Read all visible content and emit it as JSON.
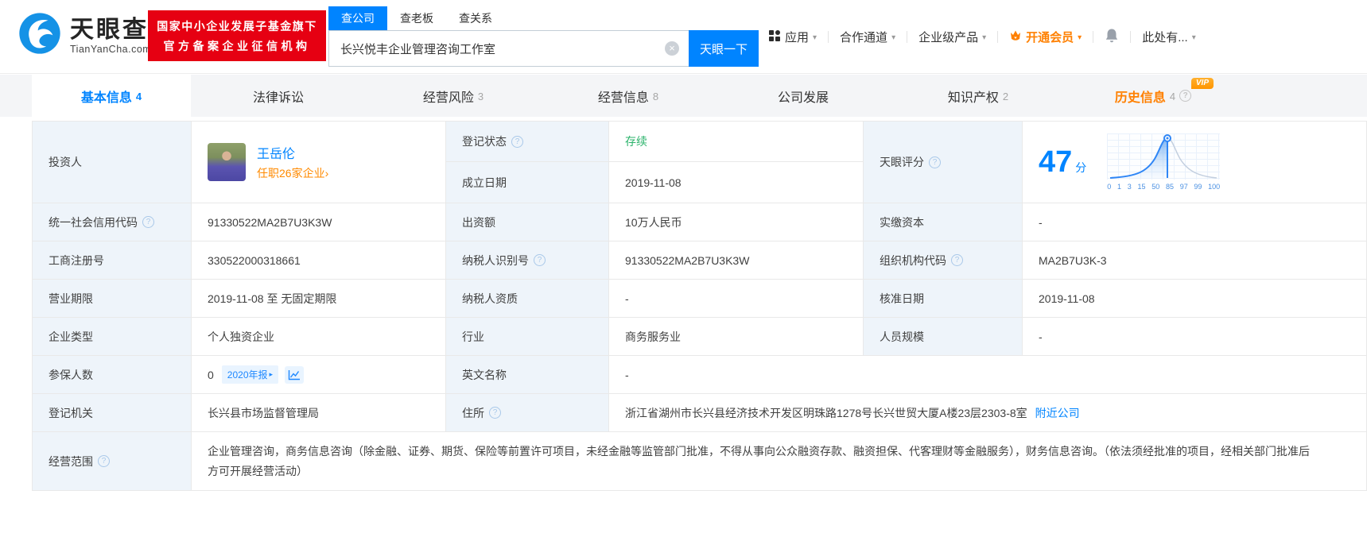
{
  "header": {
    "logo": {
      "brand": "天眼查",
      "domain": "TianYanCha.com"
    },
    "badge": {
      "line1": "国家中小企业发展子基金旗下",
      "line2": "官方备案企业征信机构"
    },
    "search": {
      "tabs": [
        {
          "label": "查公司"
        },
        {
          "label": "查老板"
        },
        {
          "label": "查关系"
        }
      ],
      "input_value": "长兴悦丰企业管理咨询工作室",
      "button": "天眼一下"
    },
    "nav": [
      {
        "label": "应用"
      },
      {
        "label": "合作通道"
      },
      {
        "label": "企业级产品"
      },
      {
        "label": "开通会员"
      },
      {
        "label": "此处有..."
      }
    ]
  },
  "tabs": [
    {
      "label": "基本信息",
      "count": "4"
    },
    {
      "label": "法律诉讼"
    },
    {
      "label": "经营风险",
      "count": "3"
    },
    {
      "label": "经营信息",
      "count": "8"
    },
    {
      "label": "公司发展"
    },
    {
      "label": "知识产权",
      "count": "2"
    },
    {
      "label": "历史信息",
      "count": "4",
      "vip": "VIP"
    }
  ],
  "profile": {
    "investor_label": "投资人",
    "investor_name": "王岳伦",
    "investor_link": "任职26家企业›",
    "reg_status_label": "登记状态",
    "reg_status_value": "存续",
    "establish_label": "成立日期",
    "establish_value": "2019-11-08",
    "score_label": "天眼评分"
  },
  "score": {
    "value": "47",
    "unit": "分",
    "ticks": [
      "0",
      "1",
      "3",
      "15",
      "50",
      "85",
      "97",
      "99",
      "100"
    ]
  },
  "rows": [
    {
      "l1": "统一社会信用代码",
      "v1": "91330522MA2B7U3K3W",
      "l2": "出资额",
      "v2": "10万人民币",
      "l3": "实缴资本",
      "v3": "-"
    },
    {
      "l1": "工商注册号",
      "v1": "330522000318661",
      "l2": "纳税人识别号",
      "v2": "91330522MA2B7U3K3W",
      "l3": "组织机构代码",
      "v3": "MA2B7U3K-3"
    },
    {
      "l1": "营业期限",
      "v1": "2019-11-08 至 无固定期限",
      "l2": "纳税人资质",
      "v2": "-",
      "l3": "核准日期",
      "v3": "2019-11-08"
    },
    {
      "l1": "企业类型",
      "v1": "个人独资企业",
      "l2": "行业",
      "v2": "商务服务业",
      "l3": "人员规模",
      "v3": "-"
    }
  ],
  "insured_row": {
    "label": "参保人数",
    "value": "0",
    "report_badge": "2020年报",
    "en_label": "英文名称",
    "en_value": "-"
  },
  "registry_row": {
    "label": "登记机关",
    "value": "长兴县市场监督管理局",
    "addr_label": "住所",
    "addr_value": "浙江省湖州市长兴县经济技术开发区明珠路1278号长兴世贸大厦A楼23层2303-8室",
    "nearby_link": "附近公司"
  },
  "scope_row": {
    "label": "经营范围",
    "value": "企业管理咨询，商务信息咨询（除金融、证券、期货、保险等前置许可项目，未经金融等监管部门批准，不得从事向公众融资存款、融资担保、代客理财等金融服务），财务信息咨询。（依法须经批准的项目，经相关部门批准后方可开展经营活动）"
  },
  "colors": {
    "accent": "#0084ff",
    "orange": "#ff8000",
    "badge_red": "#e60012",
    "status_green": "#2bb36b"
  }
}
